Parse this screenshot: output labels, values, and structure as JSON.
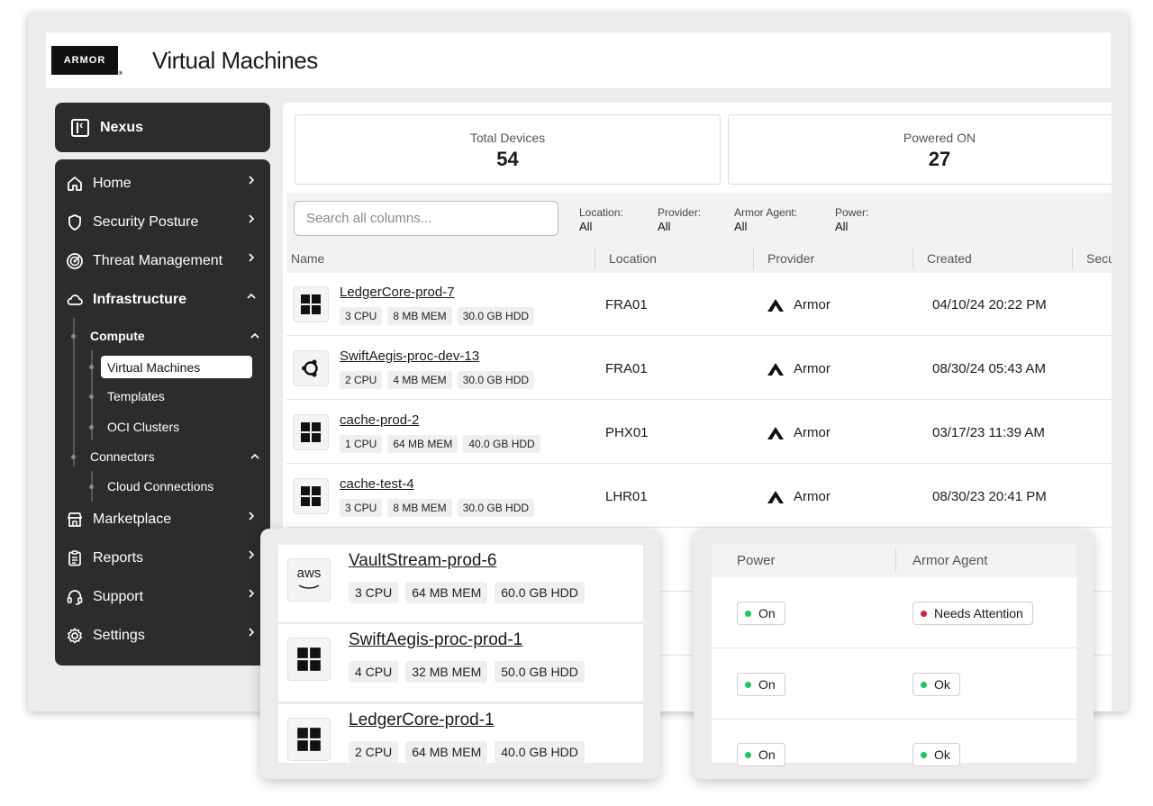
{
  "header": {
    "logo_text": "ARMOR",
    "logo_mark": "®",
    "title": "Virtual Machines"
  },
  "nexus": {
    "label": "Nexus",
    "icon": "sidebar-collapse-icon"
  },
  "sidebar": {
    "items": [
      {
        "label": "Home",
        "icon": "home-icon"
      },
      {
        "label": "Security Posture",
        "icon": "shield-icon"
      },
      {
        "label": "Threat Management",
        "icon": "radar-icon"
      },
      {
        "label": "Infrastructure",
        "icon": "cloud-icon"
      },
      {
        "label": "Marketplace",
        "icon": "store-icon"
      },
      {
        "label": "Reports",
        "icon": "clipboard-icon"
      },
      {
        "label": "Support",
        "icon": "headset-icon"
      },
      {
        "label": "Settings",
        "icon": "gear-icon"
      }
    ],
    "compute": "Compute",
    "virtual_machines": "Virtual Machines",
    "templates": "Templates",
    "oci_clusters": "OCI Clusters",
    "connectors": "Connectors",
    "cloud_connections": "Cloud Connections"
  },
  "stats": [
    {
      "label": "Total Devices",
      "value": "54"
    },
    {
      "label": "Powered ON",
      "value": "27"
    }
  ],
  "search": {
    "placeholder": "Search all columns..."
  },
  "filters": [
    {
      "label": "Location:",
      "value": "All"
    },
    {
      "label": "Provider:",
      "value": "All"
    },
    {
      "label": "Armor Agent:",
      "value": "All"
    },
    {
      "label": "Power:",
      "value": "All"
    }
  ],
  "columns": [
    "Name",
    "Location",
    "Provider",
    "Created",
    "Secu"
  ],
  "rows": [
    {
      "name": "LedgerCore-prod-7",
      "os": "windows-icon",
      "cpu": "3 CPU",
      "mem": "8 MB MEM",
      "hdd": "30.0 GB HDD",
      "location": "FRA01",
      "provider": "Armor",
      "created": "04/10/24 20:22 PM"
    },
    {
      "name": "SwiftAegis-proc-dev-13",
      "os": "ubuntu-icon",
      "cpu": "2 CPU",
      "mem": "4 MB MEM",
      "hdd": "30.0 GB HDD",
      "location": "FRA01",
      "provider": "Armor",
      "created": "08/30/24 05:43 AM"
    },
    {
      "name": "cache-prod-2",
      "os": "windows-icon",
      "cpu": "1 CPU",
      "mem": "64 MB MEM",
      "hdd": "40.0 GB HDD",
      "location": "PHX01",
      "provider": "Armor",
      "created": "03/17/23 11:39 AM"
    },
    {
      "name": "cache-test-4",
      "os": "windows-icon",
      "cpu": "3 CPU",
      "mem": "8 MB MEM",
      "hdd": "30.0 GB HDD",
      "location": "LHR01",
      "provider": "Armor",
      "created": "08/30/23 20:41 PM"
    }
  ],
  "overlay_left": [
    {
      "name": "VaultStream-prod-6",
      "os": "aws-icon",
      "os_text": "aws",
      "cpu": "3 CPU",
      "mem": "64 MB MEM",
      "hdd": "60.0 GB HDD"
    },
    {
      "name": "SwiftAegis-proc-prod-1",
      "os": "windows-icon",
      "cpu": "4 CPU",
      "mem": "32 MB MEM",
      "hdd": "50.0 GB HDD"
    },
    {
      "name": "LedgerCore-prod-1",
      "os": "windows-icon",
      "cpu": "2 CPU",
      "mem": "64 MB MEM",
      "hdd": "40.0 GB HDD"
    }
  ],
  "overlay_right": {
    "columns": [
      "Power",
      "Armor Agent"
    ],
    "rows": [
      {
        "power": "On",
        "agent": "Needs Attention",
        "agent_color": "#d81b3c"
      },
      {
        "power": "On",
        "agent": "Ok",
        "agent_color": "#22c55e"
      },
      {
        "power": "On",
        "agent": "Ok",
        "agent_color": "#22c55e"
      }
    ],
    "on_color": "#22c55e"
  }
}
